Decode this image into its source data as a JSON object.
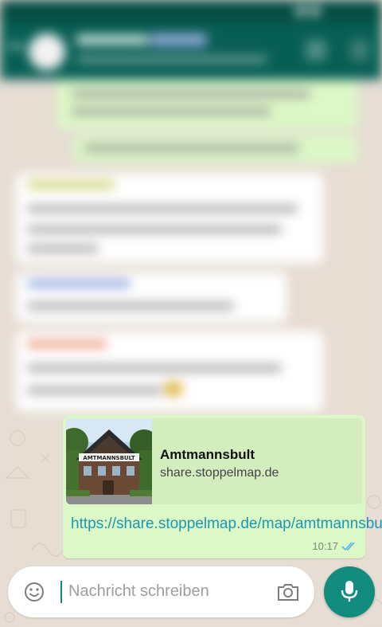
{
  "link_preview": {
    "title": "Amtmannsbult",
    "domain": "share.stoppelmap.de",
    "image_sign": "AMTMANNSBULT"
  },
  "message": {
    "url": "https://share.stoppelmap.de/map/amtmannsbult",
    "time": "10:17",
    "status": "read",
    "bubble_color": "#dcf8c6",
    "link_color": "#1b97b2"
  },
  "composer": {
    "placeholder": "Nachricht schreiben"
  },
  "icons": {
    "emoji": "emoji-icon",
    "camera": "camera-icon",
    "mic": "mic-icon",
    "read_receipt": "double-check-icon"
  },
  "theme": {
    "header": "#075e54",
    "accent": "#128c7e"
  }
}
